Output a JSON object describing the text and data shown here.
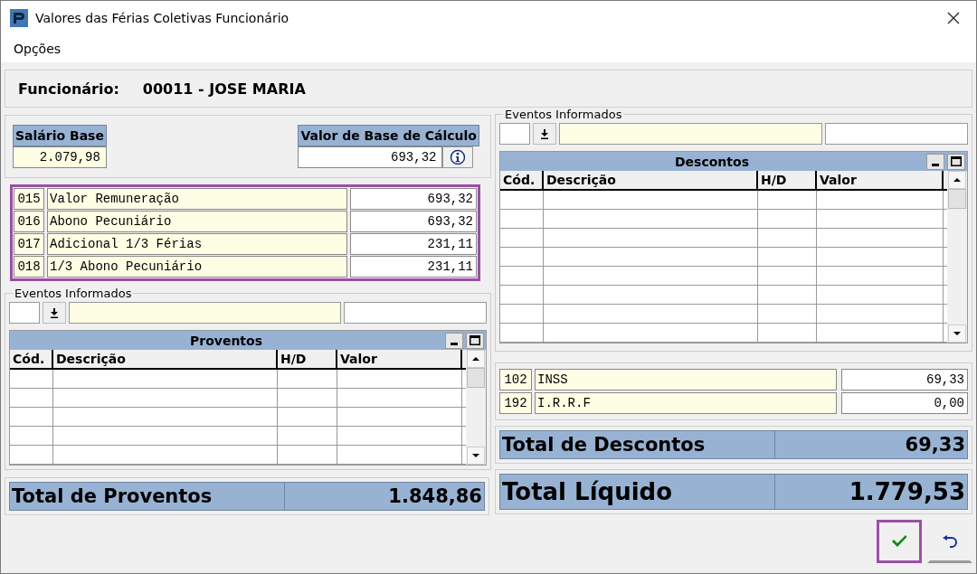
{
  "window": {
    "title": "Valores das Férias Coletivas Funcionário"
  },
  "menu": [
    "Opções"
  ],
  "employee": {
    "label": "Funcionário:",
    "value": "00011 - JOSE MARIA"
  },
  "salary_base": {
    "label": "Salário Base",
    "value": "2.079,98"
  },
  "calc_base": {
    "label": "Valor de Base de Cálculo",
    "value": "693,32"
  },
  "vacation_events": {
    "highlighted": true,
    "rows": [
      {
        "code": "015",
        "description": "Valor Remuneração",
        "value": "693,32"
      },
      {
        "code": "016",
        "description": "Abono Pecuniário",
        "value": "693,32"
      },
      {
        "code": "017",
        "description": "Adicional 1/3 Férias",
        "value": "231,11"
      },
      {
        "code": "018",
        "description": "1/3 Abono Pecuniário",
        "value": "231,11"
      }
    ]
  },
  "earnings": {
    "group_title": "Eventos Informados",
    "grid_title": "Proventos",
    "columns": [
      "Cód.",
      "Descrição",
      "H/D",
      "Valor"
    ]
  },
  "earnings_total": {
    "label": "Total de Proventos",
    "value": "1.848,86"
  },
  "deductions": {
    "group_title": "Eventos Informados",
    "grid_title": "Descontos",
    "columns": [
      "Cód.",
      "Descrição",
      "H/D",
      "Valor"
    ]
  },
  "deduction_events": [
    {
      "code": "102",
      "description": "INSS",
      "value": "69,33"
    },
    {
      "code": "192",
      "description": "I.R.R.F",
      "value": "0,00"
    }
  ],
  "deductions_total": {
    "label": "Total de Descontos",
    "value": "69,33"
  },
  "net_total": {
    "label": "Total Líquido",
    "value": "1.779,53"
  },
  "buttons": [
    {
      "kind": "confirm",
      "highlighted": true
    },
    {
      "kind": "undo",
      "highlighted": false
    }
  ]
}
